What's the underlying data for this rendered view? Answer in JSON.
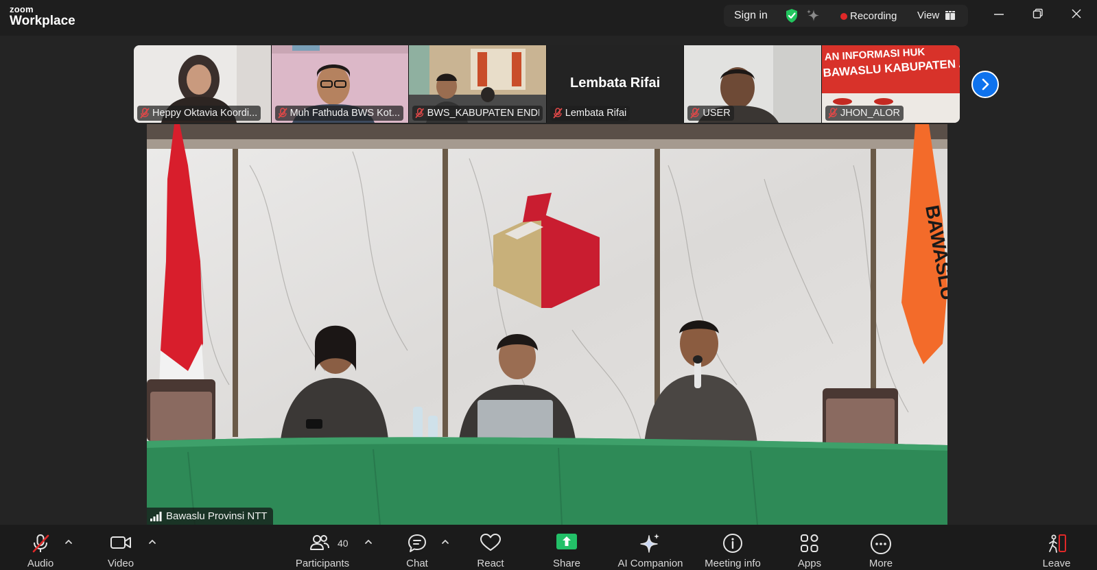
{
  "app": {
    "logo_top": "zoom",
    "logo_bottom": "Workplace",
    "sign_in": "Sign in",
    "recording": "Recording",
    "view": "View",
    "colors": {
      "accent": "#0e72ed",
      "recording": "#e02828",
      "secure": "#22c55e"
    }
  },
  "thumbnails": [
    {
      "name": "Heppy Oktavia Koordi..."
    },
    {
      "name": "Muh Fathuda BWS Kot..."
    },
    {
      "name": "BWS_KABUPATEN ENDE"
    },
    {
      "name": "Lembata Rifai",
      "display_name": "Lembata Rifai"
    },
    {
      "name": "USER"
    },
    {
      "name": "JHON_ALOR",
      "banner_text_1": "AN INFORMASI HUK",
      "banner_text_2": "BAWASLU KABUPATEN ALO"
    }
  ],
  "main": {
    "speaker": "Bawaslu Provinsi NTT",
    "banner_text": "BAWASLU"
  },
  "toolbar": {
    "audio": "Audio",
    "video": "Video",
    "participants": "Participants",
    "participants_count": "40",
    "chat": "Chat",
    "react": "React",
    "share": "Share",
    "ai_companion": "AI Companion",
    "meeting_info": "Meeting info",
    "apps": "Apps",
    "more": "More",
    "leave": "Leave"
  }
}
